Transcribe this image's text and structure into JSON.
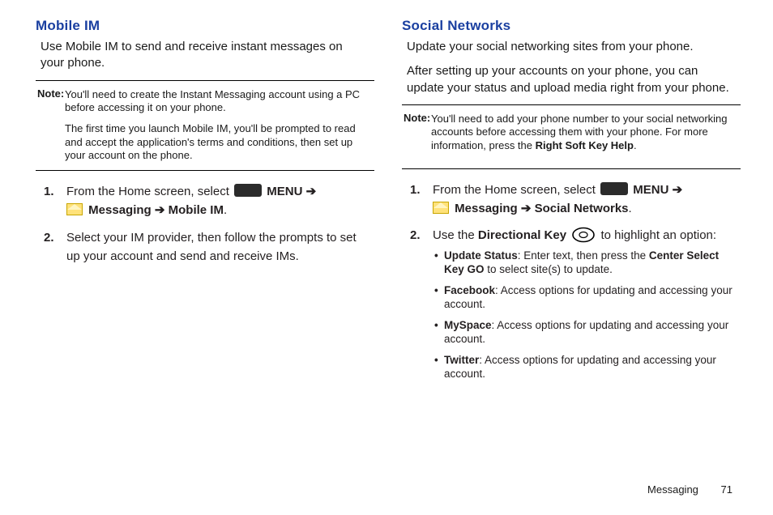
{
  "left": {
    "heading": "Mobile IM",
    "intro": "Use Mobile IM to send and receive instant messages on your phone.",
    "note_label": "Note:",
    "note_p1": "You'll need to create the Instant Messaging account using a PC before accessing it on your phone.",
    "note_p2": "The first time you launch Mobile IM, you'll be prompted to read and accept the application's terms and conditions, then set up your account on the phone.",
    "steps": [
      {
        "num": "1.",
        "pre": "From the Home screen, select ",
        "menu": "MENU",
        "arrow1": " ➔ ",
        "messaging": "Messaging",
        "arrow2": "➔ ",
        "target": "Mobile IM",
        "period": "."
      },
      {
        "num": "2.",
        "text": "Select your IM provider, then follow the prompts to set up your account and send and receive IMs."
      }
    ]
  },
  "right": {
    "heading": "Social Networks",
    "intro1": "Update your social networking sites from your phone.",
    "intro2": "After setting up your accounts on your phone, you can update your status and upload media right from your phone.",
    "note_label": "Note:",
    "note_p1a": "You'll need to add your phone number to your social networking accounts before accessing them with your phone. For more information, press the ",
    "note_p1_bold": "Right Soft Key Help",
    "note_p1b": ".",
    "steps": [
      {
        "num": "1.",
        "pre": "From the Home screen, select ",
        "menu": "MENU",
        "arrow1": " ➔ ",
        "messaging": "Messaging",
        "arrow2": " ➔ ",
        "target": "Social Networks",
        "period": "."
      },
      {
        "num": "2.",
        "pre": "Use the ",
        "dir": "Directional Key",
        "post": " to highlight an option:"
      }
    ],
    "bullets": [
      {
        "b": "Update Status",
        "t1": ": Enter text, then press the ",
        "b2": "Center Select Key GO",
        "t2": " to select site(s) to update."
      },
      {
        "b": "Facebook",
        "t1": ": Access options for updating and accessing your account."
      },
      {
        "b": "MySpace",
        "t1": ": Access options for updating and accessing your account."
      },
      {
        "b": "Twitter",
        "t1": ": Access options for updating and accessing your account."
      }
    ]
  },
  "footer": {
    "section": "Messaging",
    "page": "71"
  }
}
